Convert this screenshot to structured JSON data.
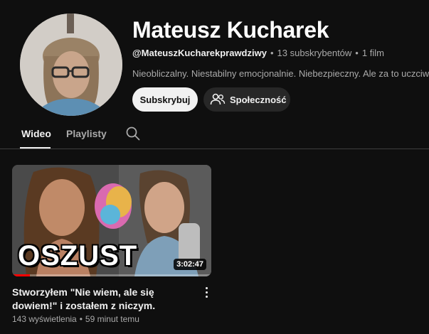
{
  "channel": {
    "name": "Mateusz Kucharek",
    "handle": "@MateuszKucharekprawdziwy",
    "subscribers": "13 subskrybentów",
    "video_count": "1 film",
    "description": "Nieobliczalny. Niestabilny emocjonalnie. Niebezpieczny. Ale za to uczciwy."
  },
  "actions": {
    "subscribe_label": "Subskrybuj",
    "community_label": "Społeczność"
  },
  "tabs": [
    {
      "label": "Wideo",
      "active": true
    },
    {
      "label": "Playlisty",
      "active": false
    }
  ],
  "video": {
    "thumbnail_text": "OSZUST",
    "duration": "3:02:47",
    "watch_progress": 0.09,
    "title": "Stworzyłem \"Nie wiem, ale się dowiem!\" i zostałem z niczym.",
    "views": "143 wyświetlenia",
    "uploaded": "59 minut temu"
  },
  "colors": {
    "background": "#0f0f0f",
    "primary_text": "#f1f1f1",
    "secondary_text": "#aaaaaa",
    "progress": "#ff0000"
  },
  "icons": {
    "community": "people-icon",
    "search": "search-icon",
    "menu": "more-vertical-icon"
  }
}
